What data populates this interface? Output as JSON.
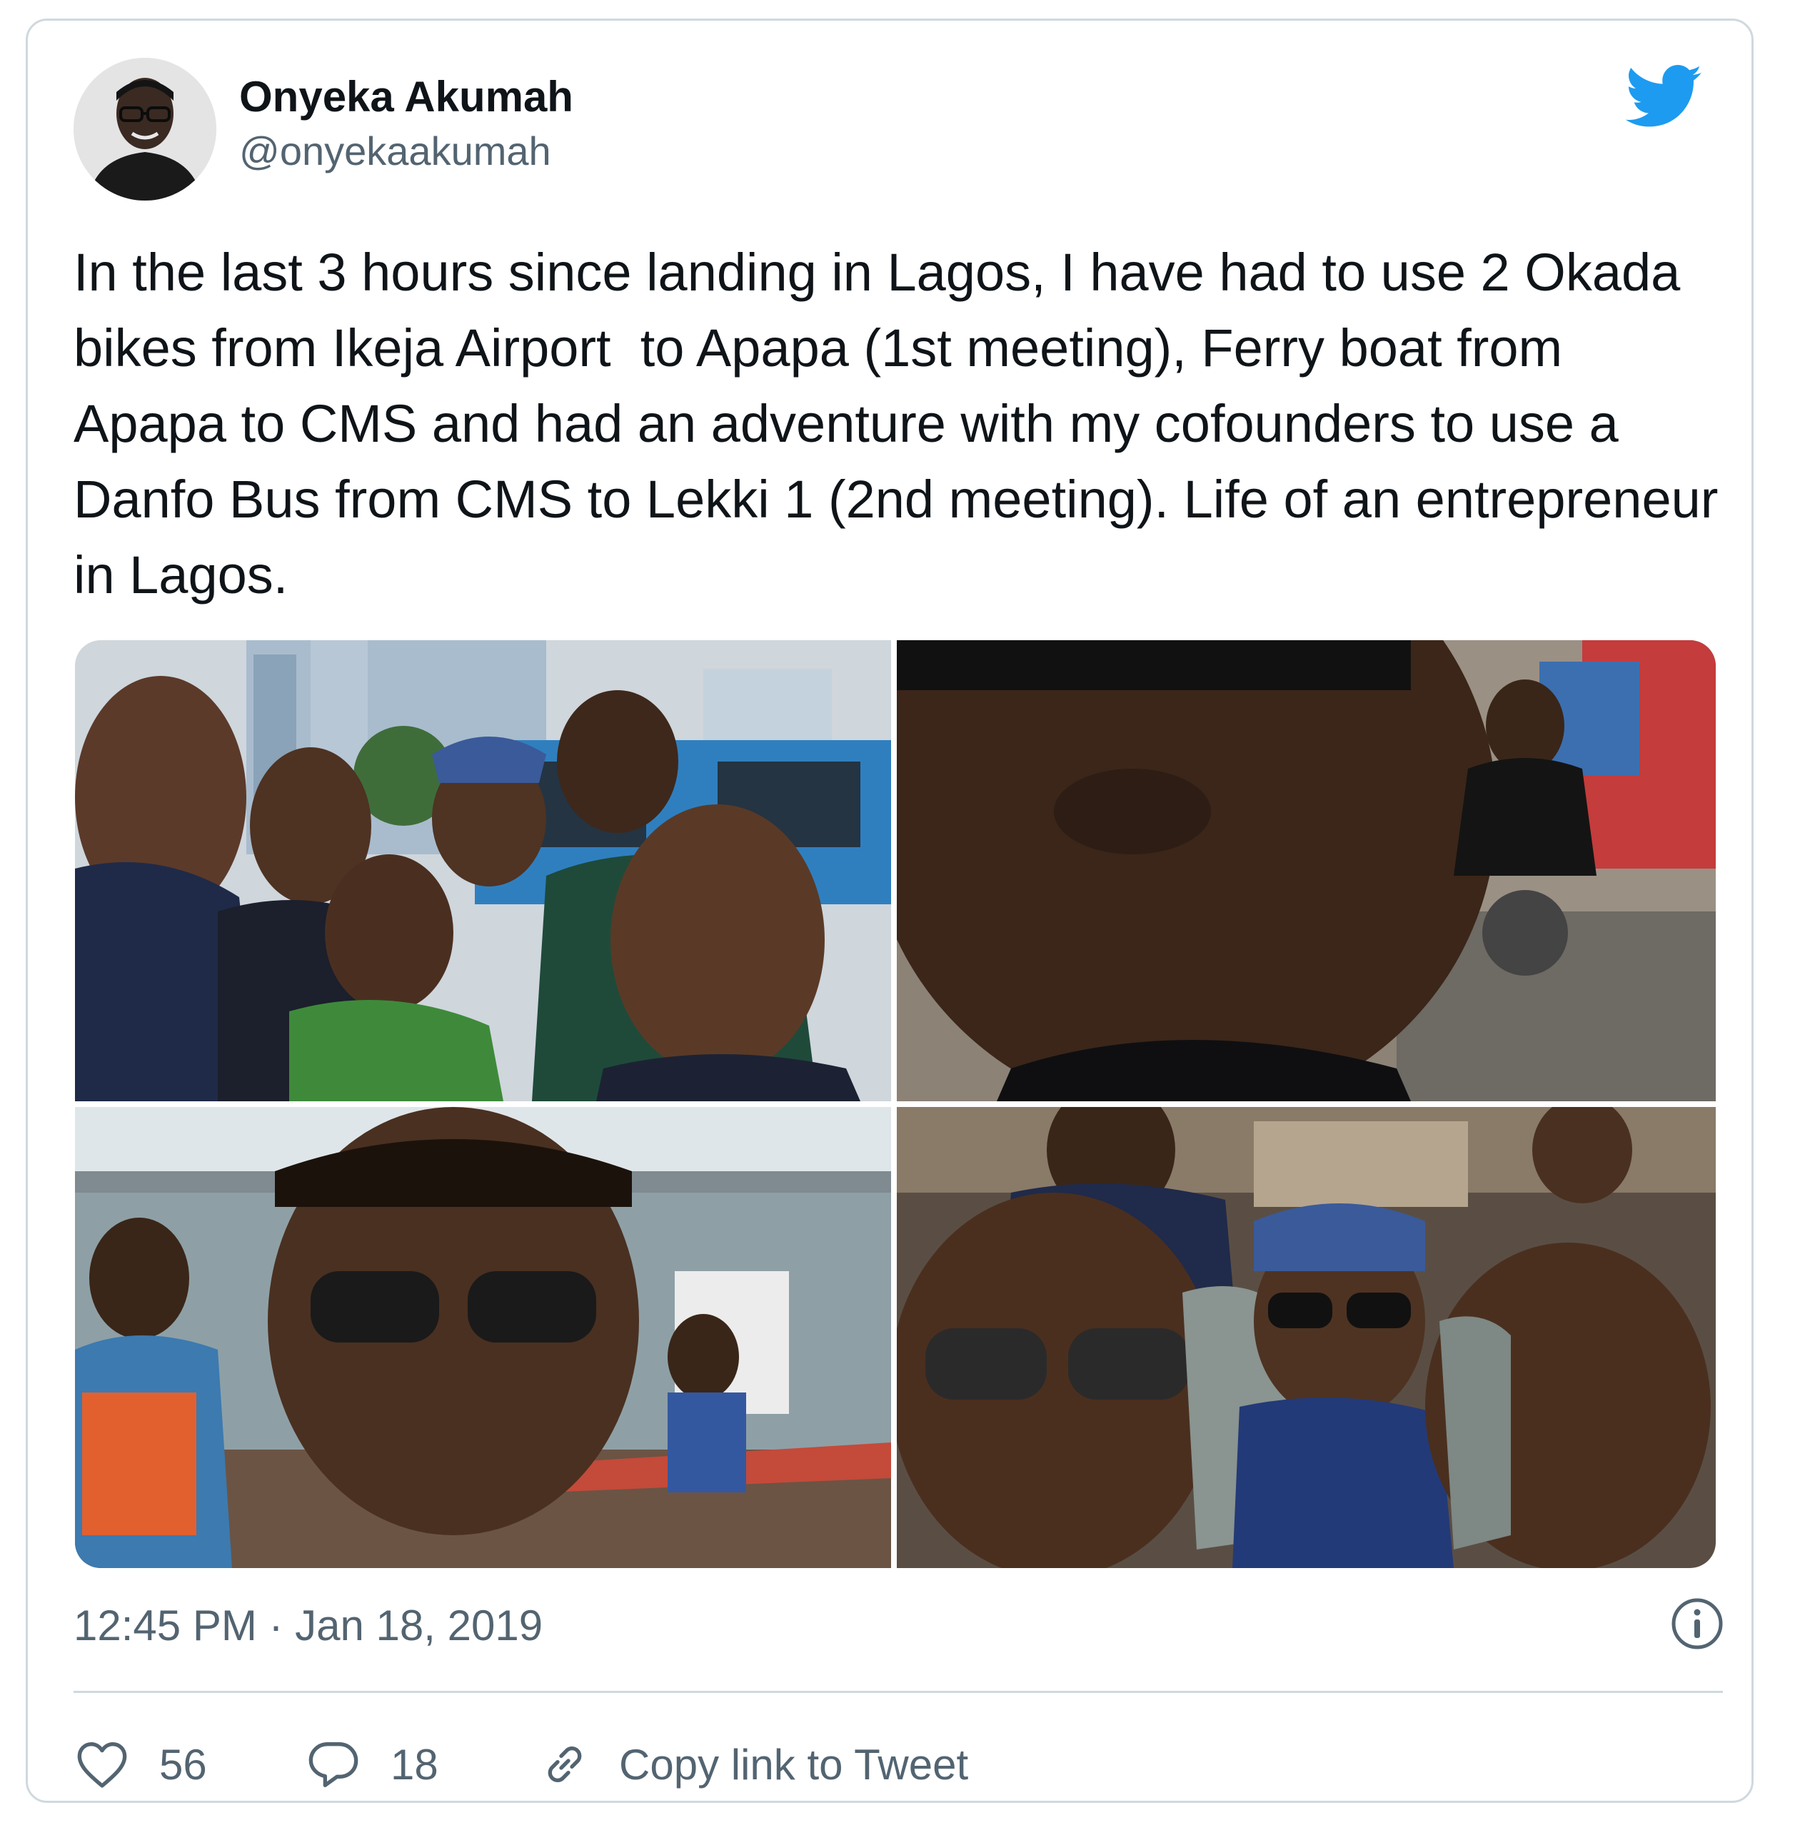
{
  "author": {
    "name": "Onyeka Akumah",
    "handle": "@onyekaakumah"
  },
  "tweet": {
    "text": "In the last 3 hours since landing in Lagos, I have had to use 2 Okada bikes from Ikeja Airport  to Apapa (1st meeting), Ferry boat from Apapa to CMS and had an adventure with my cofounders to use a Danfo Bus from CMS to Lekki 1 (2nd meeting). Life of an entrepreneur in Lagos.",
    "timestamp": "12:45 PM · Jan 18, 2019"
  },
  "actions": {
    "likes": "56",
    "replies": "18",
    "copy_link_label": "Copy link to Tweet"
  },
  "icons": {
    "brand": "twitter-bird-icon",
    "info": "info-icon",
    "like": "heart-icon",
    "reply": "speech-bubble-icon",
    "copy": "link-icon"
  },
  "colors": {
    "brand_blue": "#1d9bf0",
    "text_primary": "#0f1419",
    "text_secondary": "#536471",
    "border": "#cfd9de"
  }
}
